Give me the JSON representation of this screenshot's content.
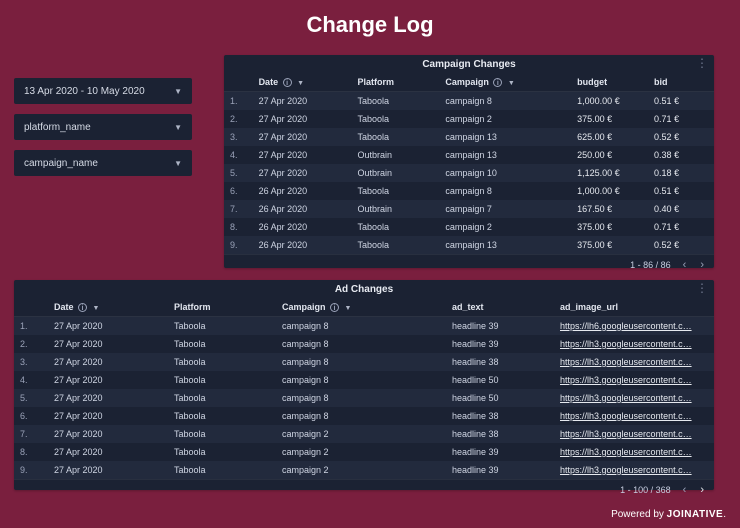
{
  "title": "Change Log",
  "filters": {
    "date_range": "13 Apr 2020 - 10 May 2020",
    "platform": "platform_name",
    "campaign": "campaign_name"
  },
  "campaign_panel": {
    "title": "Campaign Changes",
    "columns": {
      "date": "Date",
      "platform": "Platform",
      "campaign": "Campaign",
      "budget": "budget",
      "bid": "bid"
    },
    "rows": [
      {
        "idx": "1.",
        "date": "27 Apr 2020",
        "platform": "Taboola",
        "campaign": "campaign 8",
        "budget": "1,000.00 €",
        "bid": "0.51 €"
      },
      {
        "idx": "2.",
        "date": "27 Apr 2020",
        "platform": "Taboola",
        "campaign": "campaign 2",
        "budget": "375.00 €",
        "bid": "0.71 €"
      },
      {
        "idx": "3.",
        "date": "27 Apr 2020",
        "platform": "Taboola",
        "campaign": "campaign 13",
        "budget": "625.00 €",
        "bid": "0.52 €"
      },
      {
        "idx": "4.",
        "date": "27 Apr 2020",
        "platform": "Outbrain",
        "campaign": "campaign 13",
        "budget": "250.00 €",
        "bid": "0.38 €"
      },
      {
        "idx": "5.",
        "date": "27 Apr 2020",
        "platform": "Outbrain",
        "campaign": "campaign 10",
        "budget": "1,125.00 €",
        "bid": "0.18 €"
      },
      {
        "idx": "6.",
        "date": "26 Apr 2020",
        "platform": "Taboola",
        "campaign": "campaign 8",
        "budget": "1,000.00 €",
        "bid": "0.51 €"
      },
      {
        "idx": "7.",
        "date": "26 Apr 2020",
        "platform": "Outbrain",
        "campaign": "campaign 7",
        "budget": "167.50 €",
        "bid": "0.40 €"
      },
      {
        "idx": "8.",
        "date": "26 Apr 2020",
        "platform": "Taboola",
        "campaign": "campaign 2",
        "budget": "375.00 €",
        "bid": "0.71 €"
      },
      {
        "idx": "9.",
        "date": "26 Apr 2020",
        "platform": "Taboola",
        "campaign": "campaign 13",
        "budget": "375.00 €",
        "bid": "0.52 €"
      }
    ],
    "pager": "1 - 86 / 86"
  },
  "ad_panel": {
    "title": "Ad Changes",
    "columns": {
      "date": "Date",
      "platform": "Platform",
      "campaign": "Campaign",
      "ad_text": "ad_text",
      "ad_image_url": "ad_image_url"
    },
    "rows": [
      {
        "idx": "1.",
        "date": "27 Apr 2020",
        "platform": "Taboola",
        "campaign": "campaign 8",
        "ad_text": "headline 39",
        "ad_image_url": "https://lh6.googleusercontent.c…"
      },
      {
        "idx": "2.",
        "date": "27 Apr 2020",
        "platform": "Taboola",
        "campaign": "campaign 8",
        "ad_text": "headline 39",
        "ad_image_url": "https://lh3.googleusercontent.c…"
      },
      {
        "idx": "3.",
        "date": "27 Apr 2020",
        "platform": "Taboola",
        "campaign": "campaign 8",
        "ad_text": "headline 38",
        "ad_image_url": "https://lh3.googleusercontent.c…"
      },
      {
        "idx": "4.",
        "date": "27 Apr 2020",
        "platform": "Taboola",
        "campaign": "campaign 8",
        "ad_text": "headline 50",
        "ad_image_url": "https://lh3.googleusercontent.c…"
      },
      {
        "idx": "5.",
        "date": "27 Apr 2020",
        "platform": "Taboola",
        "campaign": "campaign 8",
        "ad_text": "headline 50",
        "ad_image_url": "https://lh3.googleusercontent.c…"
      },
      {
        "idx": "6.",
        "date": "27 Apr 2020",
        "platform": "Taboola",
        "campaign": "campaign 8",
        "ad_text": "headline 38",
        "ad_image_url": "https://lh3.googleusercontent.c…"
      },
      {
        "idx": "7.",
        "date": "27 Apr 2020",
        "platform": "Taboola",
        "campaign": "campaign 2",
        "ad_text": "headline 38",
        "ad_image_url": "https://lh3.googleusercontent.c…"
      },
      {
        "idx": "8.",
        "date": "27 Apr 2020",
        "platform": "Taboola",
        "campaign": "campaign 2",
        "ad_text": "headline 39",
        "ad_image_url": "https://lh3.googleusercontent.c…"
      },
      {
        "idx": "9.",
        "date": "27 Apr 2020",
        "platform": "Taboola",
        "campaign": "campaign 2",
        "ad_text": "headline 39",
        "ad_image_url": "https://lh3.googleusercontent.c…"
      }
    ],
    "pager": "1 - 100 / 368"
  },
  "footer": {
    "prefix": "Powered by ",
    "brand": "JOINATIVE",
    "suffix": "."
  }
}
